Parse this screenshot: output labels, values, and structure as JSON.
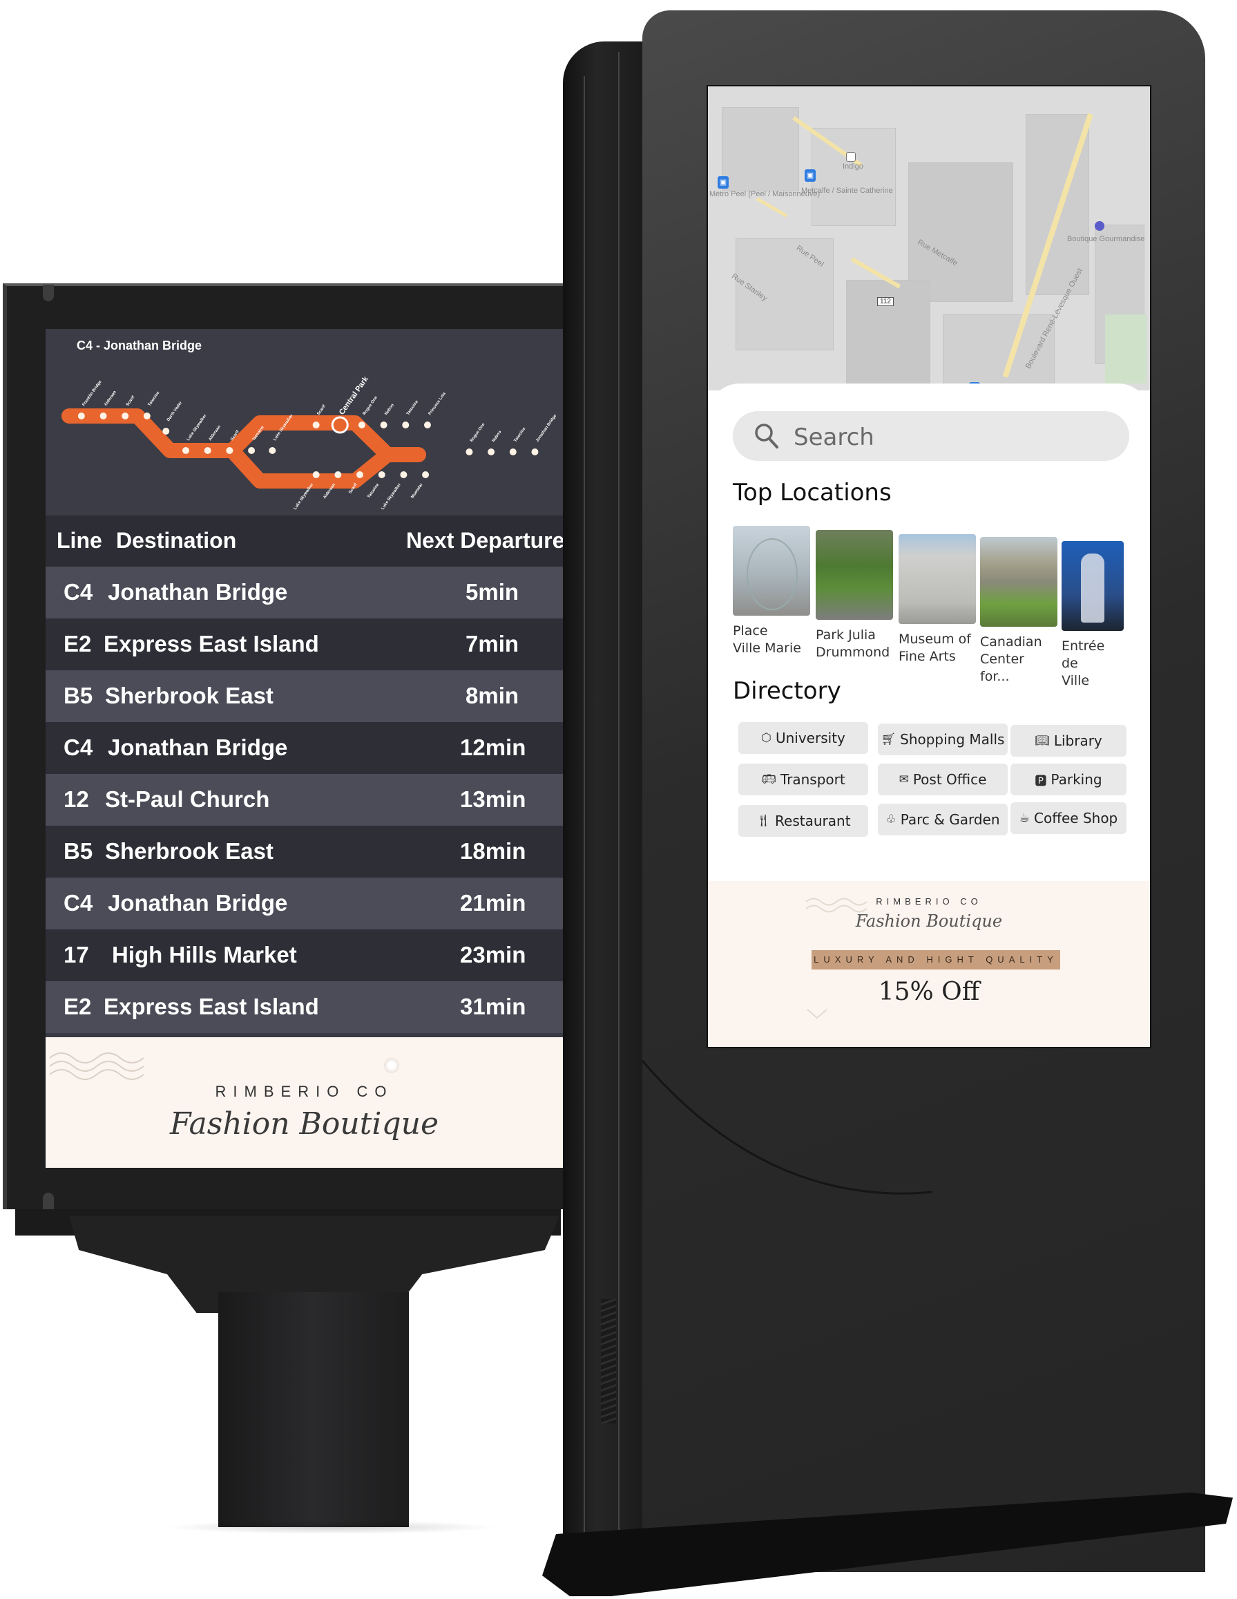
{
  "departure_board": {
    "route_map": {
      "title": "C4 - Jonathan Bridge",
      "line_color": "#e8652e",
      "current_station": "Central Park",
      "stations_upper": [
        "Franklin Bridge",
        "Alderaan",
        "Scarif",
        "Tatooine",
        "Darth Vader",
        "Luke Skywalker",
        "Alderaan",
        "Scarif",
        "Tatooine",
        "Luke Skywalker",
        "Scarif",
        "Central Park",
        "Rogue One",
        "Naboo",
        "Tatooine",
        "Princess Leia"
      ],
      "stations_loop_lower": [
        "Luke Skywalker",
        "Alderaan",
        "Scarif",
        "Tatooine",
        "Luke Skywalker",
        "Mustafar"
      ],
      "stations_end": [
        "Rogue One",
        "Naboo",
        "Tatooine",
        "Jonathan Bridge"
      ]
    },
    "columns": {
      "line": "Line",
      "destination": "Destination",
      "next_departure": "Next Departure"
    },
    "rows": [
      {
        "line": "C4",
        "destination": "Jonathan Bridge",
        "time": "5min"
      },
      {
        "line": "E2",
        "destination": "Express East Island",
        "time": "7min"
      },
      {
        "line": "B5",
        "destination": "Sherbrook East",
        "time": "8min"
      },
      {
        "line": "C4",
        "destination": "Jonathan Bridge",
        "time": "12min"
      },
      {
        "line": "12",
        "destination": "St-Paul Church",
        "time": "13min"
      },
      {
        "line": "B5",
        "destination": "Sherbrook East",
        "time": "18min"
      },
      {
        "line": "C4",
        "destination": "Jonathan Bridge",
        "time": "21min"
      },
      {
        "line": "17",
        "destination": "High Hills Market",
        "time": "23min"
      },
      {
        "line": "E2",
        "destination": "Express East Island",
        "time": "31min"
      }
    ],
    "ad": {
      "brand": "RIMBERIO CO",
      "tagline": "Fashion Boutique"
    }
  },
  "kiosk": {
    "map": {
      "labels": [
        "Métro Peel (Peel / Maisonneuve)",
        "Metcalfe / Sainte Catherine",
        "Indigo",
        "Boutique Gourmandise",
        "Rue Metcalfe",
        "Rue Peel",
        "Rue Stanley",
        "Boulevard René-Lévesque Ouest"
      ],
      "route_shield": "112"
    },
    "search": {
      "placeholder": "Search"
    },
    "top_locations": {
      "title": "Top Locations",
      "items": [
        {
          "label_line1": "Place",
          "label_line2": "Ville Marie"
        },
        {
          "label_line1": "Park Julia",
          "label_line2": "Drummond"
        },
        {
          "label_line1": "Museum of",
          "label_line2": "Fine Arts"
        },
        {
          "label_line1": "Canadian",
          "label_line2": "Center for..."
        },
        {
          "label_line1": "Entrée de",
          "label_line2": "Ville"
        }
      ]
    },
    "directory": {
      "title": "Directory",
      "items": [
        {
          "label": "University",
          "icon": "graduation-cap-icon",
          "glyph": "⬡"
        },
        {
          "label": "Shopping Malls",
          "icon": "shopping-cart-icon",
          "glyph": "🛒︎"
        },
        {
          "label": "Library",
          "icon": "book-icon",
          "glyph": "📖︎"
        },
        {
          "label": "Transport",
          "icon": "bus-icon",
          "glyph": "🚌︎"
        },
        {
          "label": "Post Office",
          "icon": "mail-icon",
          "glyph": "✉"
        },
        {
          "label": "Parking",
          "icon": "parking-icon",
          "glyph": "🅿︎"
        },
        {
          "label": "Restaurant",
          "icon": "fork-knife-icon",
          "glyph": "🍴︎"
        },
        {
          "label": "Parc & Garden",
          "icon": "tree-icon",
          "glyph": "♧"
        },
        {
          "label": "Coffee Shop",
          "icon": "coffee-cup-icon",
          "glyph": "☕︎"
        }
      ]
    },
    "ad": {
      "brand": "RIMBERIO CO",
      "tagline": "Fashion Boutique",
      "banner": "LUXURY AND HIGHT QUALITY",
      "offer": "15% Off"
    }
  }
}
